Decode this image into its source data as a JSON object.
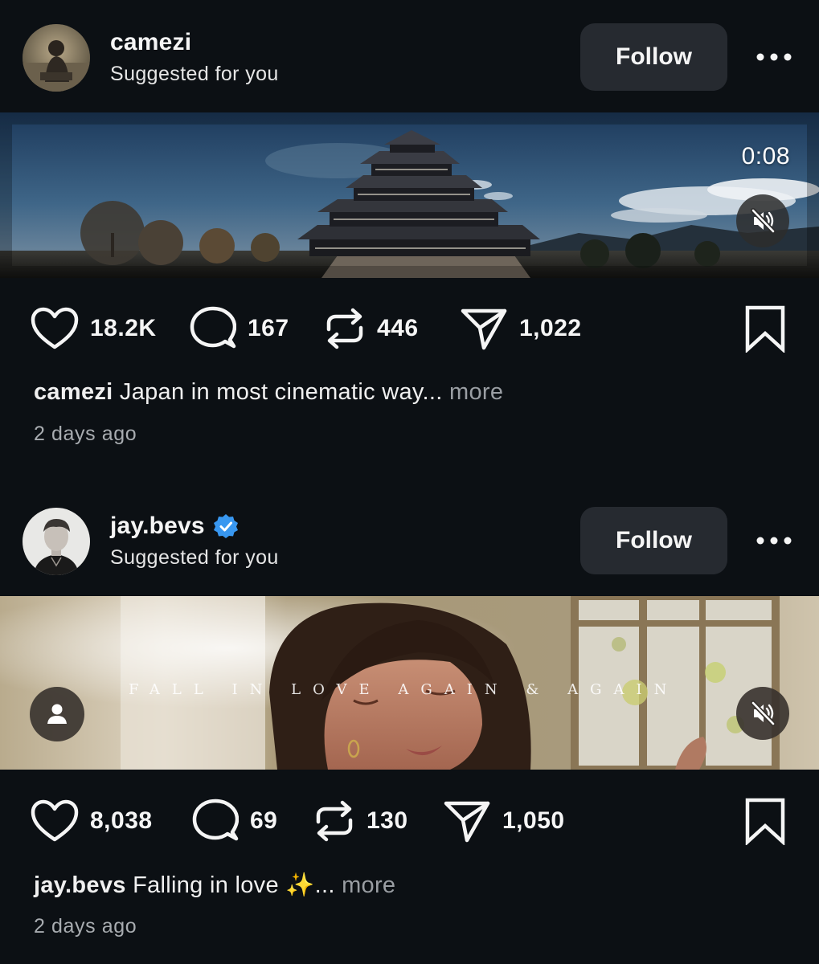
{
  "posts": [
    {
      "username": "camezi",
      "subtitle": "Suggested for you",
      "follow_label": "Follow",
      "verified": false,
      "media": {
        "duration": "0:08",
        "muted": true
      },
      "stats": {
        "likes": "18.2K",
        "comments": "167",
        "reposts": "446",
        "shares": "1,022"
      },
      "caption": {
        "user": "camezi",
        "text": " Japan in most cinematic way...",
        "more": " more"
      },
      "timestamp": "2 days ago"
    },
    {
      "username": "jay.bevs",
      "subtitle": "Suggested for you",
      "follow_label": "Follow",
      "verified": true,
      "media": {
        "overlay_text": "FALL IN LOVE AGAIN & AGAIN",
        "muted": true
      },
      "stats": {
        "likes": "8,038",
        "comments": "69",
        "reposts": "130",
        "shares": "1,050"
      },
      "caption": {
        "user": "jay.bevs",
        "text": " Falling in love ✨...",
        "more": " more"
      },
      "timestamp": "2 days ago"
    }
  ],
  "icons": {
    "like": "heart-icon",
    "comment": "comment-bubble-icon",
    "repost": "repost-arrows-icon",
    "share": "paper-plane-icon",
    "save": "bookmark-icon",
    "more": "ellipsis-icon",
    "mute": "speaker-muted-icon",
    "tag": "person-tag-icon",
    "verified": "verified-badge-icon"
  },
  "colors": {
    "background": "#0c1014",
    "button": "#262a30",
    "verified": "#3897f0",
    "muted_text": "#a8acb0"
  }
}
